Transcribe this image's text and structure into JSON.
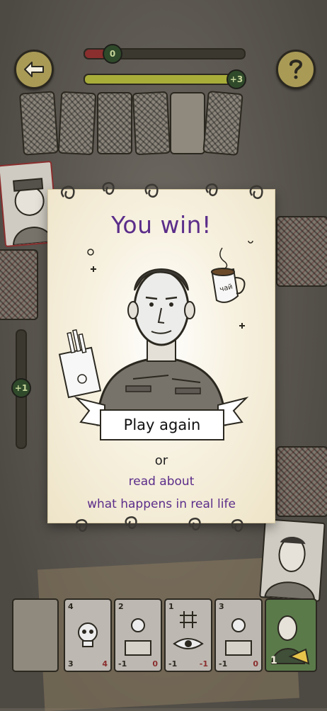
{
  "hud": {
    "score_top": "0",
    "score_bottom": "+3",
    "side_bonus": "+1",
    "progress_top_fraction": 0.13,
    "progress_bottom_fraction": 1.0
  },
  "modal": {
    "title": "You win!",
    "play_again_label": "Play again",
    "or_label": "or",
    "link_line1": "read about",
    "link_line2": "what happens in real life",
    "mug_label": "чай"
  },
  "hand": [
    {
      "top_left": "4",
      "bottom_left": "3",
      "bottom_right": "4"
    },
    {
      "top_left": "2",
      "bottom_left": "-1",
      "bottom_right": "0"
    },
    {
      "top_left": "1",
      "bottom_left": "-1",
      "bottom_right": "-1"
    },
    {
      "top_left": "3",
      "bottom_left": "-1",
      "bottom_right": "0"
    }
  ],
  "player_card_value": "1",
  "colors": {
    "accent": "#5b2d8a",
    "table": "#67625a",
    "modal_paper": "#f3ebd5"
  },
  "icons": [
    "back-arrow-icon",
    "help-question-icon",
    "skull-icon",
    "eye-icon"
  ]
}
